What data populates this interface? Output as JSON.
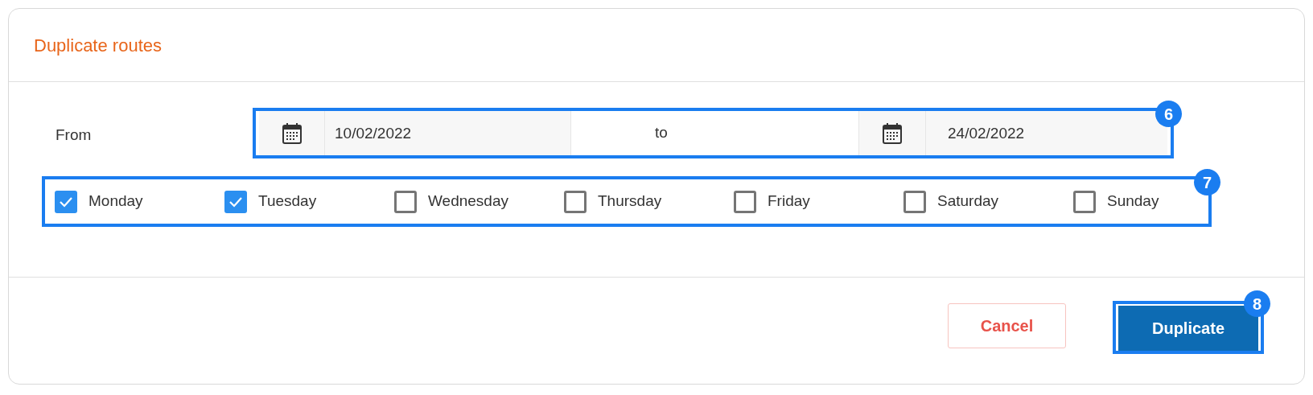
{
  "dialog": {
    "title": "Duplicate routes"
  },
  "date_range": {
    "label": "From",
    "start": "10/02/2022",
    "separator": "to",
    "end": "24/02/2022",
    "marker": "6"
  },
  "days": {
    "marker": "7",
    "items": [
      {
        "label": "Monday",
        "checked": true
      },
      {
        "label": "Tuesday",
        "checked": true
      },
      {
        "label": "Wednesday",
        "checked": false
      },
      {
        "label": "Thursday",
        "checked": false
      },
      {
        "label": "Friday",
        "checked": false
      },
      {
        "label": "Saturday",
        "checked": false
      },
      {
        "label": "Sunday",
        "checked": false
      }
    ]
  },
  "buttons": [
    {
      "label": "Cancel",
      "kind": "secondary"
    },
    {
      "label": "Duplicate",
      "kind": "primary",
      "marker": "8"
    }
  ]
}
